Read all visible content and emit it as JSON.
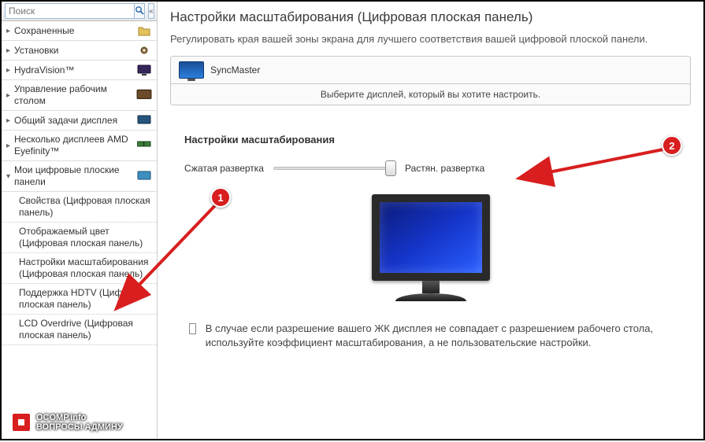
{
  "search": {
    "placeholder": "Поиск"
  },
  "sidebar": {
    "items": [
      {
        "label": "Сохраненные"
      },
      {
        "label": "Установки"
      },
      {
        "label": "HydraVision™"
      },
      {
        "label": "Управление рабочим столом"
      },
      {
        "label": "Общий задачи дисплея"
      },
      {
        "label": "Несколько дисплеев AMD Eyefinity™"
      },
      {
        "label": "Мои цифровые плоские панели"
      }
    ],
    "sub": [
      {
        "label": "Свойства (Цифровая плоская панель)"
      },
      {
        "label": "Отображаемый цвет (Цифровая плоская панель)"
      },
      {
        "label": "Настройки масштабирования (Цифровая плоская панель)"
      },
      {
        "label": "Поддержка HDTV (Цифровая плоская панель)"
      },
      {
        "label": "LCD Overdrive (Цифровая плоская панель)"
      }
    ]
  },
  "main": {
    "title": "Настройки масштабирования (Цифровая плоская панель)",
    "desc": "Регулировать края вашей зоны экрана для лучшего соответствия вашей цифровой плоской панели.",
    "display_name": "SyncMaster",
    "display_hint": "Выберите дисплей, который вы хотите настроить.",
    "group_title": "Настройки масштабирования",
    "slider_left": "Сжатая развертка",
    "slider_right": "Растян. развертка",
    "check_text": "В случае если разрешение вашего ЖК дисплея не совпадает с разрешением рабочего стола, используйте коэффициент масштабирования, а не пользовательские настройки."
  },
  "annotations": {
    "one": "1",
    "two": "2"
  },
  "watermark": {
    "line1": "OCOMP.info",
    "line2": "ВОПРОСЫ АДМИНУ"
  }
}
